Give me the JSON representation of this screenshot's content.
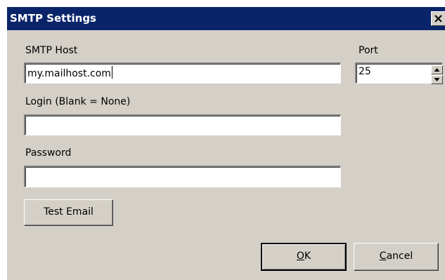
{
  "window": {
    "title": "SMTP Settings",
    "close_glyph": "×"
  },
  "fields": {
    "host_label": "SMTP Host",
    "host_value": "my.mailhost.com",
    "port_label": "Port",
    "port_value": "25",
    "login_label": "Login (Blank = None)",
    "login_value": "",
    "password_label": "Password",
    "password_value": ""
  },
  "buttons": {
    "test_email": "Test Email",
    "ok_mnemonic": "O",
    "ok_rest": "K",
    "cancel_mnemonic": "C",
    "cancel_rest": "ancel"
  },
  "icons": {
    "close": "close-icon",
    "spin_up": "arrow-up-icon",
    "spin_down": "arrow-down-icon"
  },
  "colors": {
    "titlebar": "#0a246a",
    "dialog_bg": "#d4d0c8"
  }
}
